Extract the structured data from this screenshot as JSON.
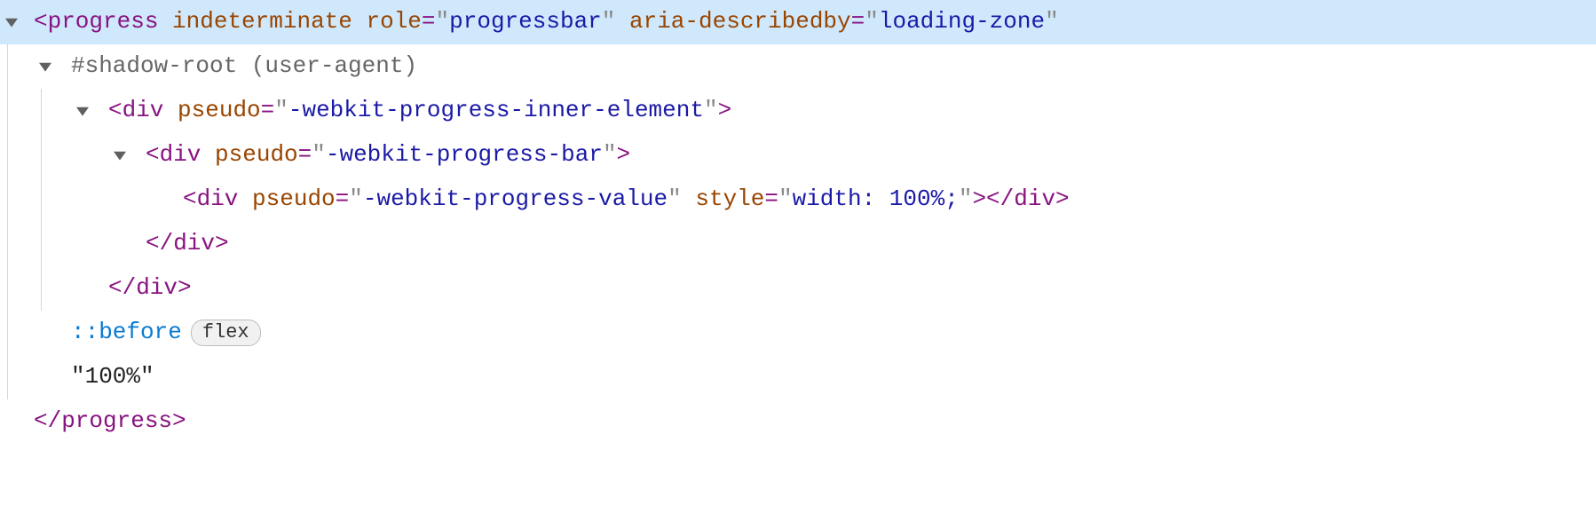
{
  "line1": {
    "tag_open": "<progress",
    "attr1_name": "indeterminate",
    "attr2_name": "role",
    "attr2_value": "progressbar",
    "attr3_name": "aria-describedby",
    "attr3_value": "loading-zone"
  },
  "line2": {
    "text": "#shadow-root (user-agent)"
  },
  "line3": {
    "tag_open": "<div",
    "attr_name": "pseudo",
    "attr_value": "-webkit-progress-inner-element",
    "close": ">"
  },
  "line4": {
    "tag_open": "<div",
    "attr_name": "pseudo",
    "attr_value": "-webkit-progress-bar",
    "close": ">"
  },
  "line5": {
    "tag_open": "<div",
    "attr1_name": "pseudo",
    "attr1_value": "-webkit-progress-value",
    "attr2_name": "style",
    "attr2_value": "width: 100%;",
    "mid": ">",
    "close_tag": "</div>"
  },
  "line6": {
    "text": "</div>"
  },
  "line7": {
    "text": "</div>"
  },
  "line8": {
    "pseudo": "::before",
    "pill": "flex"
  },
  "line9": {
    "text": "\"100%\""
  },
  "line10": {
    "text": "</progress>"
  },
  "common": {
    "eq": "=",
    "q": "\"",
    "space": " "
  }
}
